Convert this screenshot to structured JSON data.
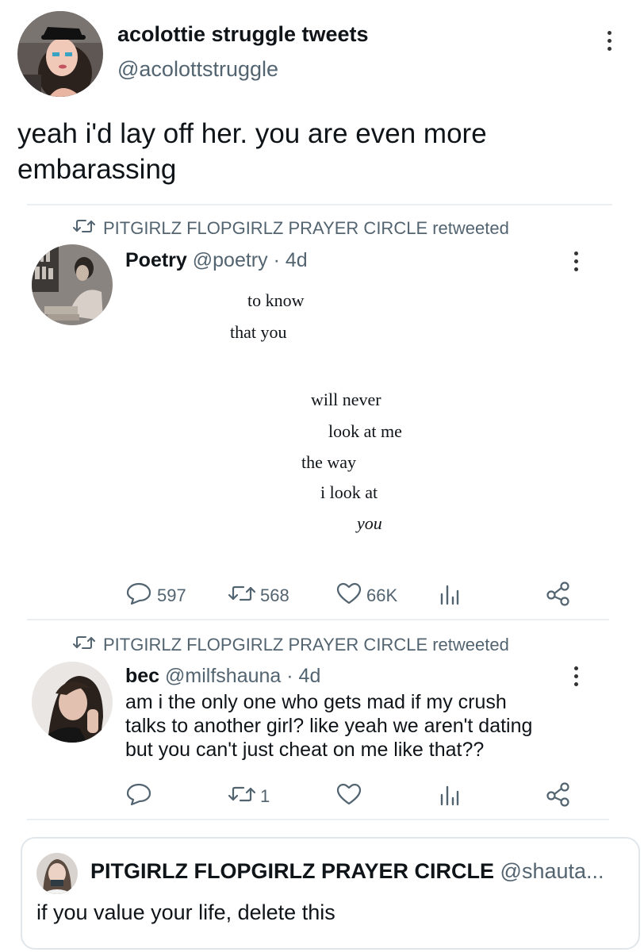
{
  "main_tweet": {
    "display_name": "acolottie struggle tweets",
    "handle": "@acolottstruggle",
    "text_line1": "yeah i'd lay off her. you are even more",
    "text_line2": "embarassing"
  },
  "retweet1": {
    "context": "PITGIRLZ FLOPGIRLZ PRAYER CIRCLE retweeted",
    "display_name": "Poetry",
    "handle_time": "@poetry · 4d",
    "poem": [
      "to know",
      "that you",
      "will never",
      "look at me",
      "the way",
      "i look at",
      "you"
    ],
    "replies": "597",
    "retweets": "568",
    "likes": "66K"
  },
  "retweet2": {
    "context": "PITGIRLZ FLOPGIRLZ PRAYER CIRCLE retweeted",
    "display_name": "bec",
    "handle_time": "@milfshauna · 4d",
    "text_lines": [
      "am i the only one who gets mad if my crush",
      "talks to another girl? like yeah we aren't dating",
      "but you can't just cheat on me like that??"
    ],
    "retweets": "1"
  },
  "quoted_tweet": {
    "display_name": "PITGIRLZ FLOPGIRLZ PRAYER CIRCLE",
    "handle": "@shauta...",
    "text": "if you value your life, delete this"
  },
  "icons": [
    "more-icon",
    "retweet-icon",
    "reply-icon",
    "like-icon",
    "analytics-icon",
    "share-icon"
  ],
  "colors": {
    "text": "#0f1419",
    "muted": "#536471",
    "divider": "#eceff1"
  }
}
